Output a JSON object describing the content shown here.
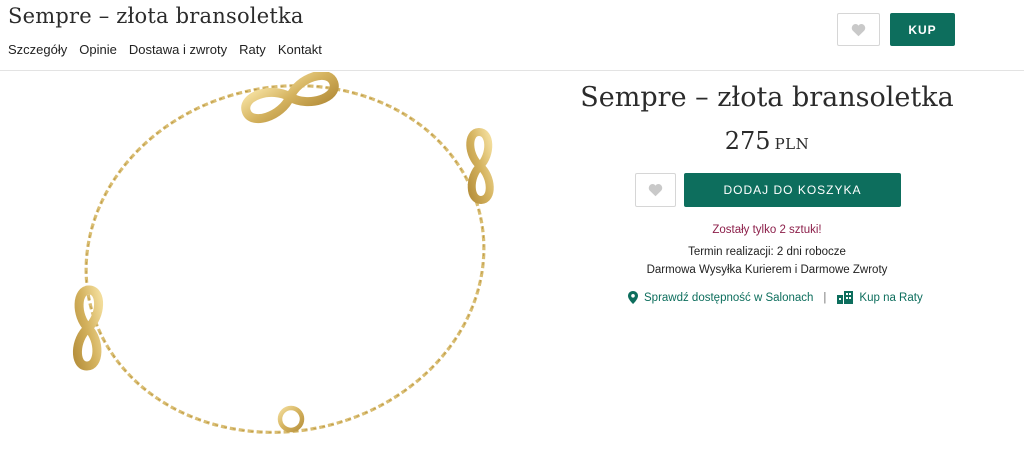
{
  "header": {
    "title": "Sempre – złota bransoletka",
    "nav": [
      "Szczegóły",
      "Opinie",
      "Dostawa i zwroty",
      "Raty",
      "Kontakt"
    ],
    "buy_label": "KUP"
  },
  "product": {
    "title": "Sempre – złota bransoletka",
    "price": "275",
    "currency": "PLN",
    "add_to_cart_label": "DODAJ DO KOSZYKA",
    "stock_notice": "Zostały tylko 2 sztuki!",
    "lead_time": "Termin realizacji: 2 dni robocze",
    "shipping": "Darmowa Wysyłka Kurierem i Darmowe Zwroty",
    "check_availability_label": "Sprawdź dostępność w Salonach",
    "separator": "|",
    "installments_label": "Kup na Raty"
  },
  "icons": {
    "wishlist": "heart-icon",
    "location": "map-pin-icon",
    "installments": "shop-icon"
  },
  "colors": {
    "accent": "#0d6e5d",
    "stock_warning": "#8c1f4a",
    "gold": "#d4b25e"
  }
}
